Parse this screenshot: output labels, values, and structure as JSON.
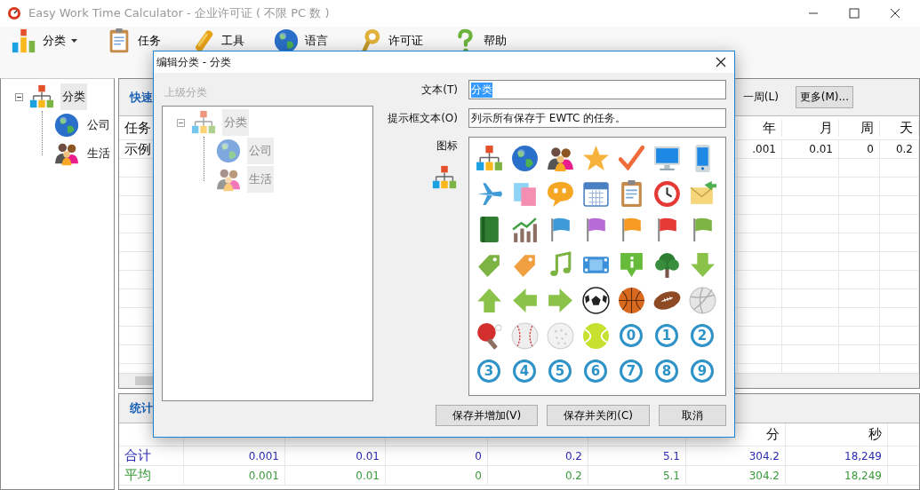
{
  "window": {
    "title": "Easy Work Time Calculator - 企业许可证 ( 不限 PC 数 )"
  },
  "toolbar": [
    {
      "label": "分类",
      "kind": "bars",
      "dropdown": true
    },
    {
      "label": "任务",
      "kind": "clipboard",
      "dropdown": false
    },
    {
      "label": "工具",
      "kind": "tool",
      "dropdown": false
    },
    {
      "label": "语言",
      "kind": "globe",
      "dropdown": false
    },
    {
      "label": "许可证",
      "kind": "key",
      "dropdown": false
    },
    {
      "label": "帮助",
      "kind": "help",
      "dropdown": false
    }
  ],
  "category_tree": {
    "label": "分类",
    "kind": "hierarchy",
    "expanded": true,
    "selected": true,
    "children": [
      {
        "label": "公司",
        "kind": "globe",
        "selected": false
      },
      {
        "label": "生活",
        "kind": "people",
        "selected": false
      }
    ]
  },
  "quick_panel": {
    "tab": "快速",
    "buttons": [
      {
        "label": "一周(L)",
        "kind": "flat"
      },
      {
        "label": "更多(M)...",
        "kind": "raised"
      }
    ]
  },
  "task_table": {
    "columns": [
      "任务",
      "年",
      "月",
      "周",
      "天"
    ],
    "rows": [
      [
        "示例",
        ".001",
        "0.01",
        "0",
        "0.2"
      ]
    ]
  },
  "stats": {
    "tab": "统计",
    "header_labels": [
      "分",
      "秒"
    ],
    "rows": [
      {
        "label": "合计",
        "color": "#2b2bb0",
        "values": [
          "0.001",
          "0.01",
          "0",
          "0.2",
          "5.1",
          "304.2",
          "18,249"
        ]
      },
      {
        "label": "平均",
        "color": "#3a9a3a",
        "values": [
          "0.001",
          "0.01",
          "0",
          "0.2",
          "5.1",
          "304.2",
          "18,249"
        ]
      }
    ]
  },
  "dialog": {
    "title": "编辑分类 - 分类",
    "parent_label": "上级分类",
    "parent_tree": {
      "label": "分类",
      "kind": "hierarchy",
      "expanded": true,
      "children": [
        {
          "label": "公司",
          "kind": "globe"
        },
        {
          "label": "生活",
          "kind": "people"
        }
      ]
    },
    "text_label": "文本(T)",
    "text_value": "分类",
    "text_selected": true,
    "tooltip_label": "提示框文本(O)",
    "tooltip_value": "列示所有保存于 EWTC 的任务。",
    "icon_label": "图标",
    "number_icons": [
      "0",
      "1",
      "2",
      "3",
      "4",
      "5",
      "6",
      "7",
      "8",
      "9"
    ],
    "buttons": [
      "保存并增加(V)",
      "保存并关闭(C)",
      "取消"
    ]
  }
}
